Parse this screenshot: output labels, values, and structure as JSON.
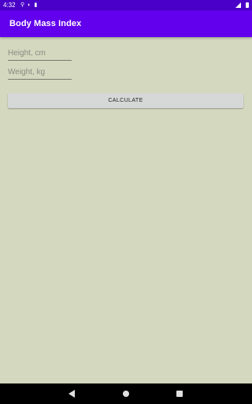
{
  "status_bar": {
    "time": "4:32",
    "icons": [
      "bluetooth-icon",
      "sync-icon",
      "sim-icon",
      "signal-icon",
      "battery-icon"
    ]
  },
  "app_bar": {
    "title": "Body Mass Index"
  },
  "form": {
    "height_placeholder": "Height, cm",
    "height_value": "",
    "weight_placeholder": "Weight, kg",
    "weight_value": "",
    "calculate_label": "CALCULATE"
  },
  "navigation": {
    "icons": [
      "back-icon",
      "home-icon",
      "recents-icon"
    ]
  },
  "colors": {
    "status_bar": "#4a00c8",
    "app_bar": "#6200ee",
    "background": "#d4d8bf",
    "button": "#d6d7d7"
  }
}
